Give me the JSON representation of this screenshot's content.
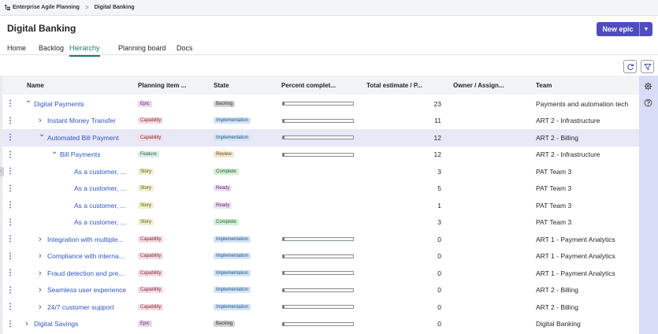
{
  "breadcrumb": {
    "items": [
      "Enterprise Agile Planning",
      "Digital Banking"
    ],
    "separator": ">"
  },
  "header": {
    "title": "Digital Banking",
    "new_epic_label": "New epic",
    "dropdown_glyph": "▼"
  },
  "tabs": [
    {
      "label": "Home",
      "active": false
    },
    {
      "label": "Backlog",
      "active": false
    },
    {
      "label": "Hierarchy",
      "active": true
    },
    {
      "label": "Planning board",
      "active": false
    },
    {
      "label": "Docs",
      "active": false
    }
  ],
  "toolbar": {
    "refresh_icon": "refresh-icon",
    "filter_icon": "filter-icon"
  },
  "columns": {
    "name": "Name",
    "planning_item": "Planning item ...",
    "state": "State",
    "percent": "Percent complet...",
    "estimate": "Total estimate / P...",
    "owner": "Owner / Assign...",
    "team": "Team"
  },
  "rows": [
    {
      "name": "Digital Payments",
      "level": 0,
      "expanded": true,
      "type": "Epic",
      "state": "Backlog",
      "progress": 0.02,
      "estimate": "23",
      "team": "Payments and automation tech",
      "selected": false
    },
    {
      "name": "Instant Money Transfer",
      "level": 1,
      "expanded": false,
      "type": "Capability",
      "state": "Implementation",
      "progress": 0.02,
      "estimate": "11",
      "team": "ART 2 - Infrastructure",
      "selected": false
    },
    {
      "name": "Automated Bill Payment",
      "level": 1,
      "expanded": true,
      "type": "Capability",
      "state": "Implementation",
      "progress": 0.02,
      "estimate": "12",
      "team": "ART 2 - Billing",
      "selected": true
    },
    {
      "name": "Bill Payments",
      "level": 2,
      "expanded": true,
      "type": "Feature",
      "state": "Review",
      "progress": 0.02,
      "estimate": "12",
      "team": "ART 2 - Infrastructure",
      "selected": false
    },
    {
      "name": "As a customer, ...",
      "level": 3,
      "expanded": null,
      "type": "Story",
      "state": "Complete",
      "progress": null,
      "estimate": "3",
      "team": "PAT Team 3",
      "selected": false
    },
    {
      "name": "As a customer, ...",
      "level": 3,
      "expanded": null,
      "type": "Story",
      "state": "Ready",
      "progress": null,
      "estimate": "5",
      "team": "PAT Team 3",
      "selected": false
    },
    {
      "name": "As a customer, ...",
      "level": 3,
      "expanded": null,
      "type": "Story",
      "state": "Ready",
      "progress": null,
      "estimate": "1",
      "team": "PAT Team 3",
      "selected": false
    },
    {
      "name": "As a customer, ...",
      "level": 3,
      "expanded": null,
      "type": "Story",
      "state": "Complete",
      "progress": null,
      "estimate": "3",
      "team": "PAT Team 3",
      "selected": false
    },
    {
      "name": "Integration with multiple...",
      "level": 1,
      "expanded": false,
      "type": "Capability",
      "state": "Implementation",
      "progress": 0.02,
      "estimate": "0",
      "team": "ART 1 - Payment Analytics",
      "selected": false
    },
    {
      "name": "Compliance with interna...",
      "level": 1,
      "expanded": false,
      "type": "Capability",
      "state": "Implementation",
      "progress": 0.02,
      "estimate": "0",
      "team": "ART 1 - Payment Analytics",
      "selected": false
    },
    {
      "name": "Fraud detection and pre...",
      "level": 1,
      "expanded": false,
      "type": "Capability",
      "state": "Implementation",
      "progress": 0.02,
      "estimate": "0",
      "team": "ART 1 - Payment Analytics",
      "selected": false
    },
    {
      "name": "Seamless user experience",
      "level": 1,
      "expanded": false,
      "type": "Capability",
      "state": "Implementation",
      "progress": 0.02,
      "estimate": "0",
      "team": "ART 2 - Billing",
      "selected": false
    },
    {
      "name": "24/7 customer support",
      "level": 1,
      "expanded": false,
      "type": "Capability",
      "state": "Implementation",
      "progress": 0.02,
      "estimate": "0",
      "team": "ART 2 - Billing",
      "selected": false
    },
    {
      "name": "Digital Savings",
      "level": 0,
      "expanded": false,
      "type": "Epic",
      "state": "Backlog",
      "progress": 0.02,
      "estimate": "0",
      "team": "Digital Banking",
      "selected": false
    }
  ],
  "rail": {
    "settings_icon": "gear-icon",
    "help_icon": "help-icon"
  },
  "colors": {
    "accent": "#4f4cc0",
    "link": "#2e55c9",
    "active_tab": "#1f7a61",
    "selected_row": "#e9e8f7"
  }
}
